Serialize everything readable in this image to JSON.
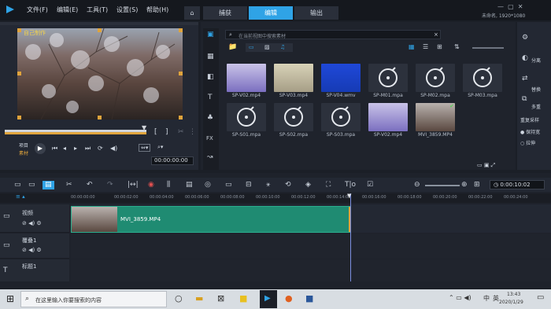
{
  "menu": {
    "file": "文件(F)",
    "edit": "编辑(E)",
    "tools": "工具(T)",
    "settings": "设置(S)",
    "help": "帮助(H)"
  },
  "tabs": {
    "capture": "捕获",
    "edit": "编辑",
    "output": "输出"
  },
  "project_info": "未命名, 1920*1080",
  "preview": {
    "watermark": "自己制作",
    "mode_project": "项目",
    "mode_clip": "素材",
    "timecode": "00:00:00:00"
  },
  "library": {
    "search_placeholder": "在当前视图中搜索素材",
    "items": [
      {
        "name": "SP-V02.mp4"
      },
      {
        "name": "SP-V03.mp4"
      },
      {
        "name": "SP-V04.wmv"
      },
      {
        "name": "SP-M01.mpa"
      },
      {
        "name": "SP-M02.mpa"
      },
      {
        "name": "SP-M03.mpa"
      },
      {
        "name": "SP-S01.mpa"
      },
      {
        "name": "SP-S02.mpa"
      },
      {
        "name": "SP-S03.mpa"
      },
      {
        "name": "SP-V02.mp4"
      },
      {
        "name": "MVI_3859.MP4"
      }
    ]
  },
  "right_panel": {
    "items": [
      "分离",
      "替换",
      "多重",
      "重复采样",
      "保持宽",
      "拉伸"
    ]
  },
  "timeline": {
    "timecode": "0:00:10:02",
    "ruler": [
      "00:00:00:00",
      "00:00:02:00",
      "00:00:04:00",
      "00:00:06:00",
      "00:00:08:00",
      "00:00:10:00",
      "00:00:12:00",
      "00:00:14:00",
      "00:00:16:00",
      "00:00:18:00",
      "00:00:20:00",
      "00:00:22:00",
      "00:00:24:00"
    ],
    "tracks": [
      {
        "label": "视频"
      },
      {
        "label": "覆叠1"
      },
      {
        "label": "标题1"
      }
    ],
    "clip_name": "MVI_3859.MP4"
  },
  "taskbar": {
    "search_placeholder": "在这里输入你要搜索的内容",
    "clock_time": "13:43",
    "clock_date": "2020/1/29",
    "ime": "中",
    "lang": "英"
  }
}
